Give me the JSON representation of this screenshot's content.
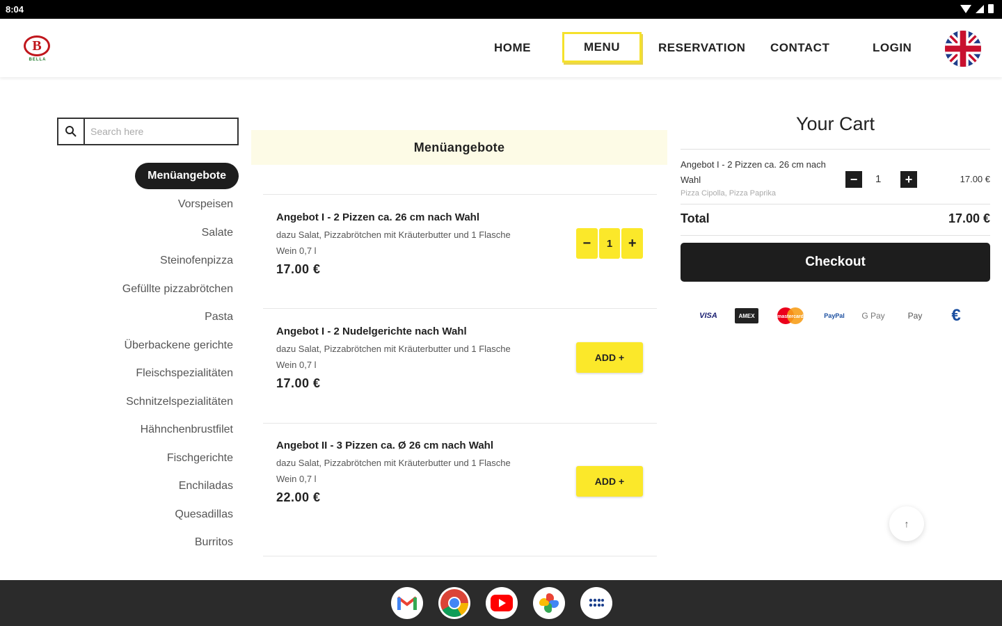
{
  "status_bar": {
    "time": "8:04"
  },
  "nav": {
    "logo_letter": "B",
    "logo_sub": "BELLA",
    "home": "HOME",
    "menu": "MENU",
    "reservation": "RESERVATION",
    "contact": "CONTACT",
    "login": "LOGIN",
    "language_icon": "uk-flag-icon"
  },
  "search": {
    "placeholder": "Search here"
  },
  "categories": [
    "Menüangebote",
    "Vorspeisen",
    "Salate",
    "Steinofenpizza",
    "Gefüllte pizzabrötchen",
    "Pasta",
    "Überbackene gerichte",
    "Fleischspezialitäten",
    "Schnitzelspezialitäten",
    "Hähnchenbrustfilet",
    "Fischgerichte",
    "Enchiladas",
    "Quesadillas",
    "Burritos"
  ],
  "section": {
    "title": "Menüangebote"
  },
  "items": [
    {
      "title": "Angebot I - 2 Pizzen ca. 26 cm nach Wahl",
      "desc": "dazu Salat, Pizzabrötchen mit Kräuterbutter und 1 Flasche Wein 0,7 l",
      "price": "17.00 €",
      "quantity": "1"
    },
    {
      "title": "Angebot I - 2 Nudelgerichte nach Wahl",
      "desc": "dazu Salat, Pizzabrötchen mit Kräuterbutter und 1 Flasche Wein 0,7 l",
      "price": "17.00 €",
      "button": "ADD +"
    },
    {
      "title": "Angebot II - 3 Pizzen ca. Ø 26 cm nach Wahl",
      "desc": "dazu Salat, Pizzabrötchen mit Kräuterbutter und 1 Flasche Wein 0,7 l",
      "price": "22.00 €",
      "button": "ADD +"
    }
  ],
  "cart": {
    "title": "Your Cart",
    "item_name": "Angebot I - 2 Pizzen ca. 26 cm nach Wahl",
    "item_options": "Pizza Cipolla, Pizza Paprika",
    "item_qty": "1",
    "item_price": "17.00 €",
    "total_label": "Total",
    "total_value": "17.00 €",
    "checkout": "Checkout"
  },
  "payments": [
    "VISA",
    "AMEX",
    "mastercard",
    "PayPal",
    "G Pay",
    "Pay",
    "€"
  ],
  "dock_apps": [
    "gmail-icon",
    "chrome-icon",
    "youtube-icon",
    "photos-icon",
    "app-drawer-icon"
  ]
}
